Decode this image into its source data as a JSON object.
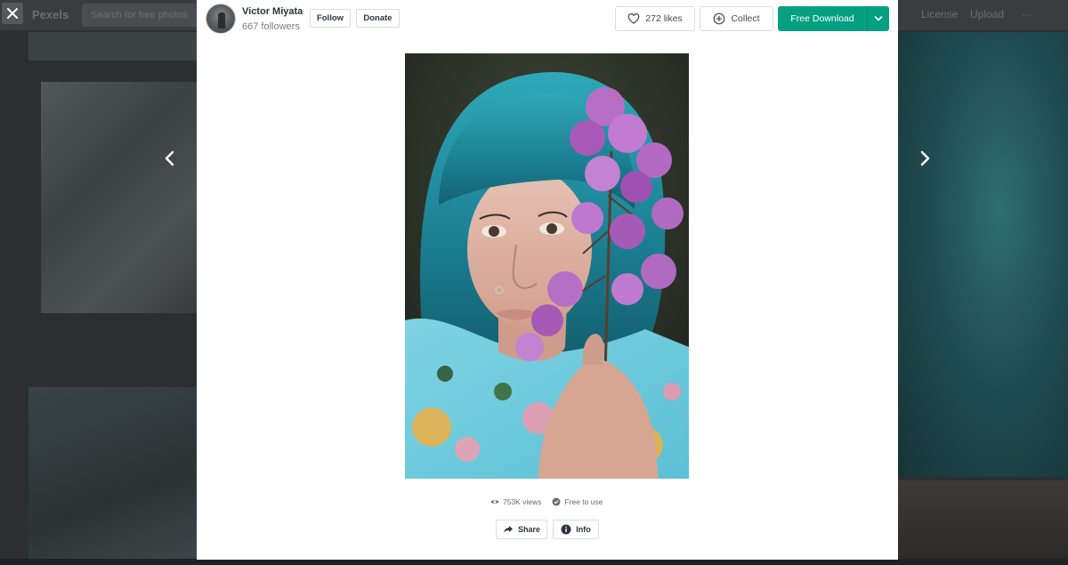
{
  "background": {
    "logo": "Pexels",
    "search_placeholder": "Search for free photos",
    "nav_items": [
      "License",
      "Upload",
      "···"
    ]
  },
  "author": {
    "name": "Victor Miyata",
    "followers": "667 followers"
  },
  "actions": {
    "follow_label": "Follow",
    "donate_label": "Donate",
    "likes_label": "272 likes",
    "collect_label": "Collect",
    "download_label": "Free Download"
  },
  "stats": {
    "views": "753K views",
    "license": "Free to use"
  },
  "footer_actions": {
    "share_label": "Share",
    "info_label": "Info"
  },
  "colors": {
    "accent": "#05a081",
    "overlay": "#2b2f31"
  },
  "icons": {
    "close": "close-icon",
    "prev": "chevron-left-icon",
    "next": "chevron-right-icon",
    "like": "heart-icon",
    "collect": "plus-circle-icon",
    "download_menu": "chevron-down-icon",
    "views": "eye-icon",
    "license": "check-circle-icon",
    "share": "share-arrow-icon",
    "info": "info-icon"
  }
}
